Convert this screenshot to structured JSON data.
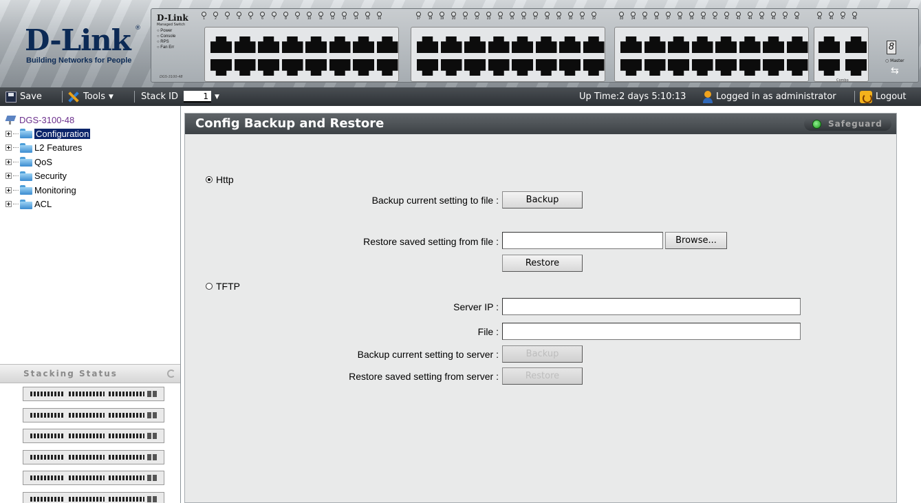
{
  "banner": {
    "logo_text": "D-Link",
    "logo_tagline": "Building Networks for People",
    "switch_brand": "D-Link",
    "switch_sub": "Managed Switch",
    "switch_leds": [
      "Power",
      "Console",
      "RPS",
      "Fan Err"
    ],
    "switch_model": "DGS-3100-48",
    "combo_label": "Combo",
    "stack_digit": "8",
    "master_label": "Master",
    "port_numbers_a": [
      "1",
      "2",
      "3",
      "4",
      "5",
      "6",
      "7",
      "8",
      "9",
      "10",
      "11",
      "12",
      "13",
      "14",
      "15",
      "16"
    ],
    "port_numbers_b": [
      "17",
      "18",
      "19",
      "20",
      "21",
      "22",
      "23",
      "24",
      "25",
      "26",
      "27",
      "28",
      "29",
      "30",
      "31",
      "32"
    ],
    "port_numbers_c": [
      "33",
      "34",
      "35",
      "36",
      "37",
      "38",
      "39",
      "40",
      "41",
      "42",
      "43",
      "44",
      "45",
      "46",
      "47",
      "48"
    ],
    "port_numbers_d": [
      "45",
      "46",
      "47",
      "48"
    ]
  },
  "toolbar": {
    "save": "Save",
    "tools": "Tools",
    "stack_id_label": "Stack ID",
    "stack_id_value": "1",
    "uptime": "Up Time:2 days 5:10:13",
    "logged_in": "Logged in as administrator",
    "logout": "Logout"
  },
  "tree": {
    "root": "DGS-3100-48",
    "items": [
      {
        "label": "Configuration",
        "selected": true
      },
      {
        "label": "L2 Features"
      },
      {
        "label": "QoS"
      },
      {
        "label": "Security"
      },
      {
        "label": "Monitoring"
      },
      {
        "label": "ACL"
      }
    ]
  },
  "stacking": {
    "title": "Stacking Status",
    "units": 6
  },
  "main": {
    "title": "Config Backup and Restore",
    "safeguard": "Safeguard",
    "http": {
      "label": "Http",
      "checked": true,
      "backup_label": "Backup current setting to file :",
      "backup_button": "Backup",
      "restore_label": "Restore saved setting from file :",
      "restore_file_value": "",
      "browse_button": "Browse...",
      "restore_button": "Restore"
    },
    "tftp": {
      "label": "TFTP",
      "checked": false,
      "server_ip_label": "Server IP :",
      "server_ip_value": "",
      "file_label": "File :",
      "file_value": "",
      "backup_label": "Backup current setting to server :",
      "backup_button": "Backup",
      "restore_label": "Restore saved setting from server :",
      "restore_button": "Restore"
    }
  }
}
